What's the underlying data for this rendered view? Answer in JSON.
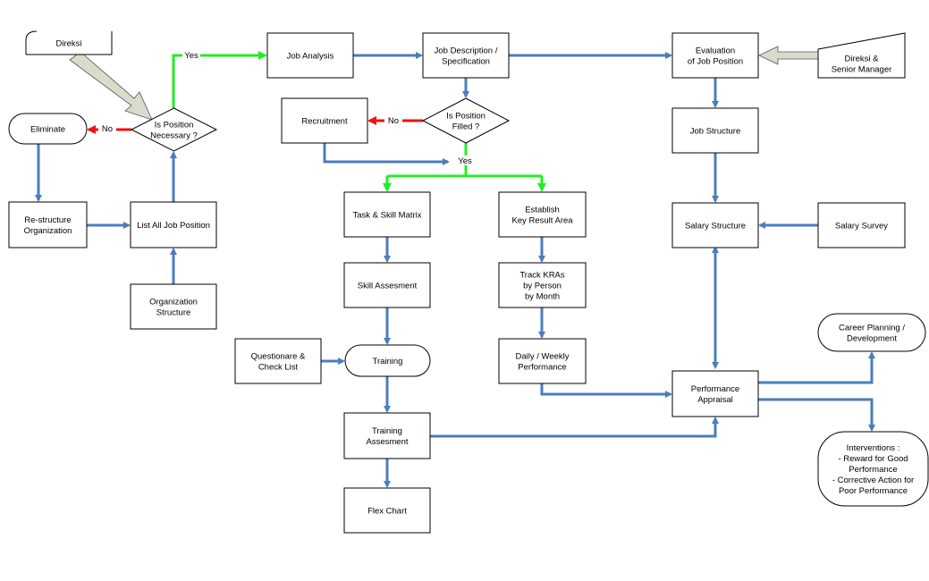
{
  "colors": {
    "flow": "#4a7ebb",
    "yes": "#22ee22",
    "no": "#ee1111",
    "input_arrow": "#d8dccb"
  },
  "nodes": {
    "direksi": [
      "Direksi"
    ],
    "eliminate": [
      "Eliminate"
    ],
    "position_necessary": [
      "Is Position",
      "Necessary ?"
    ],
    "restructure": [
      "Re-structure",
      "Organization"
    ],
    "list_all": [
      "List All Job Position"
    ],
    "org_structure": [
      "Organization",
      "Structure"
    ],
    "job_analysis": [
      "Job Analysis"
    ],
    "job_description": [
      "Job Description /",
      "Specification"
    ],
    "evaluation": [
      "Evaluation",
      "of Job Position"
    ],
    "direksi_senior": [
      "Direksi &",
      "Senior Manager"
    ],
    "recruitment": [
      "Recruitment"
    ],
    "position_filled": [
      "Is Position",
      "Filled ?"
    ],
    "job_structure": [
      "Job Structure"
    ],
    "task_skill": [
      "Task & Skill Matrix"
    ],
    "key_result": [
      "Establish",
      "Key Result Area"
    ],
    "salary_structure": [
      "Salary Structure"
    ],
    "salary_survey": [
      "Salary Survey"
    ],
    "skill_assesment": [
      "Skill Assesment"
    ],
    "track_kras": [
      "Track KRAs",
      "by Person",
      "by Month"
    ],
    "questionare": [
      "Questionare &",
      "Check List"
    ],
    "training": [
      "Training"
    ],
    "daily_weekly": [
      "Daily /  Weekly",
      "Performance"
    ],
    "career": [
      "Career Planning /",
      "Development"
    ],
    "appraisal": [
      "Performance",
      "Appraisal"
    ],
    "training_assesment": [
      "Training",
      "Assesment"
    ],
    "interventions": [
      "Interventions :",
      "- Reward for Good",
      "Performance",
      "- Corrective Action for",
      "Poor Performance"
    ],
    "flex_chart": [
      "Flex Chart"
    ]
  },
  "labels": {
    "yes1": "Yes",
    "no1": "No",
    "no2": "No",
    "yes2": "Yes"
  }
}
